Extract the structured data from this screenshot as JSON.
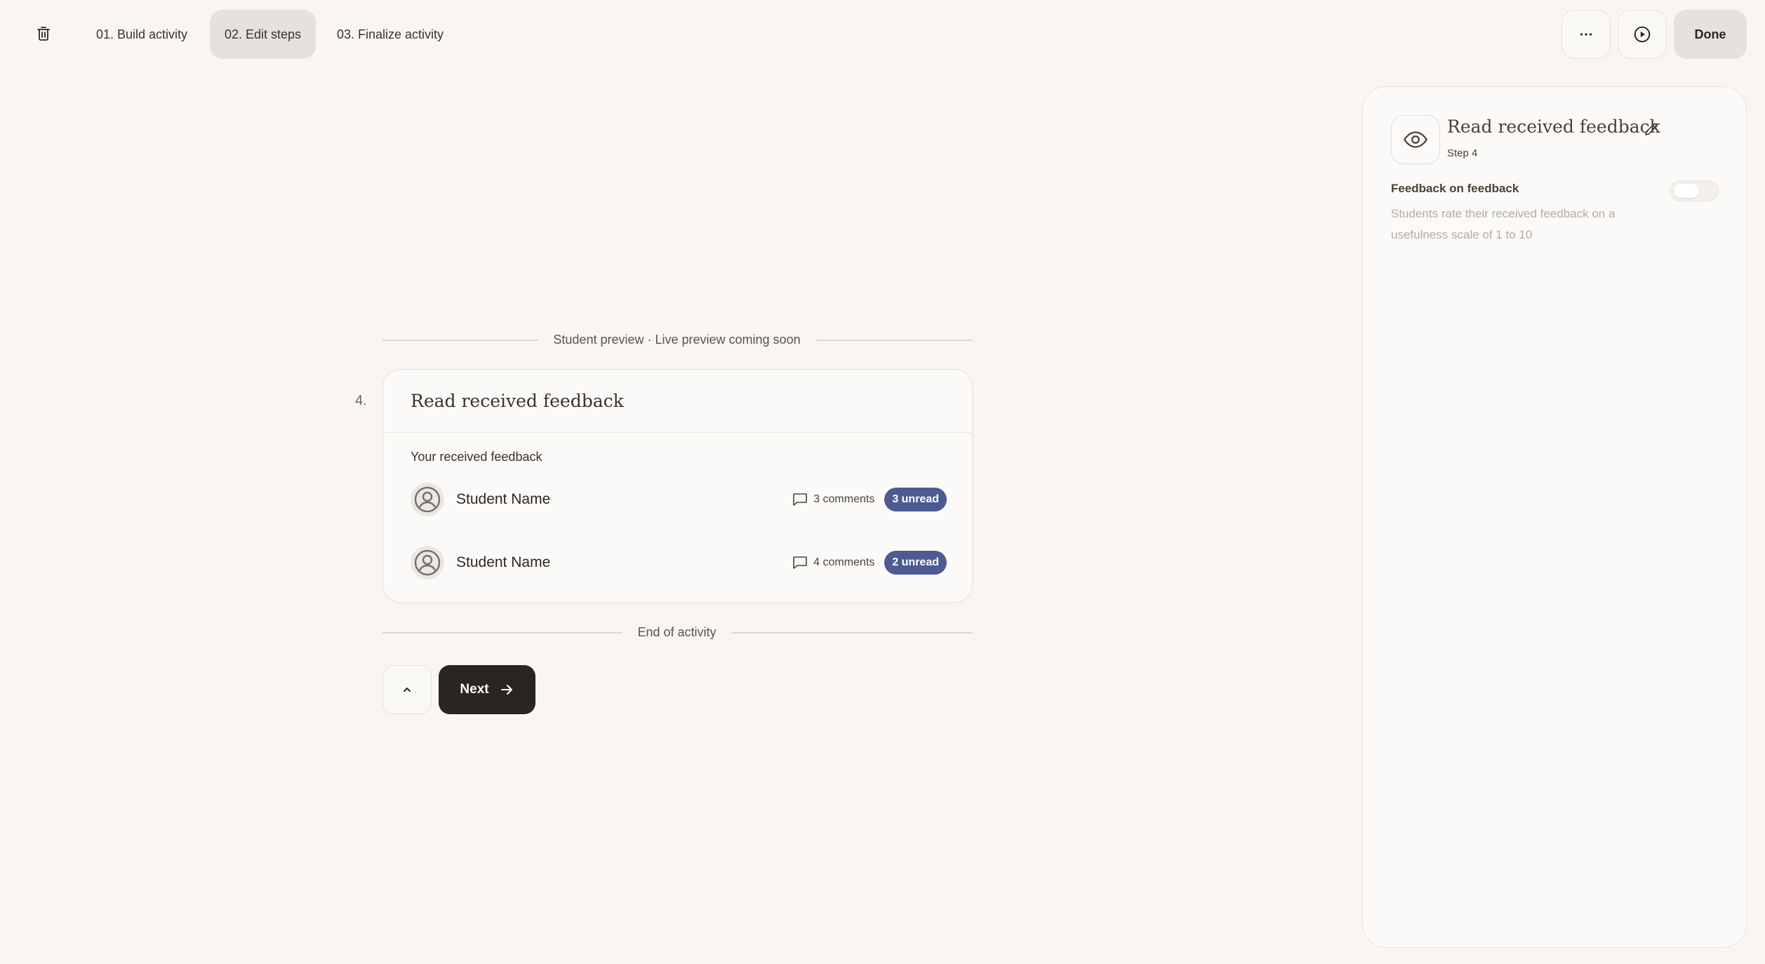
{
  "topbar": {
    "tabs": [
      {
        "label": "01. Build activity"
      },
      {
        "label": "02. Edit steps"
      },
      {
        "label": "03. Finalize activity"
      }
    ],
    "more_icon": "more-horizontal-icon",
    "play_icon": "play-icon",
    "delete_icon": "trash-icon",
    "done_label": "Done"
  },
  "preview": {
    "header_label": "Student preview · Live preview coming soon",
    "step_number": "4.",
    "card": {
      "title": "Read received feedback",
      "subheading": "Your received feedback",
      "rows": [
        {
          "name": "Student Name",
          "comments": "3 comments",
          "unread": "3 unread"
        },
        {
          "name": "Student Name",
          "comments": "4 comments",
          "unread": "2 unread"
        }
      ]
    },
    "end_label": "End of activity",
    "next_label": "Next"
  },
  "panel": {
    "step_icon": "eye-icon",
    "title": "Read received feedback",
    "step_label": "Step 4",
    "setting": {
      "label": "Feedback on feedback",
      "description": "Students rate their received feedback on a usefulness scale of 1 to 10",
      "enabled": false
    }
  },
  "colors": {
    "background": "#f9f6f2",
    "badge": "#4d5b92",
    "primary_button": "#2a2520",
    "active_tab": "#e5e1dc"
  }
}
